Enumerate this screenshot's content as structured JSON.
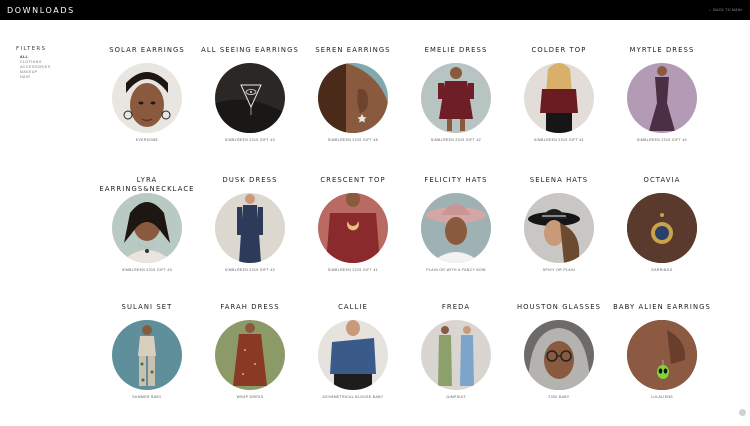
{
  "header": {
    "title": "DOWNLOADS",
    "back_link": "← BACK TO MAIN"
  },
  "filters": {
    "title": "FILTERS",
    "items": [
      {
        "label": "ALL",
        "active": true
      },
      {
        "label": "CLOTHING",
        "active": false
      },
      {
        "label": "ACCESSORIES",
        "active": false
      },
      {
        "label": "MAKEUP",
        "active": false
      },
      {
        "label": "HAIR",
        "active": false
      }
    ]
  },
  "items": [
    {
      "title": "SOLAR EARRINGS",
      "subtitle": "EVERSOME",
      "bg": "#e9e6e1",
      "motif": "face-earrings"
    },
    {
      "title": "ALL SEEING EARRINGS",
      "subtitle": "SIMBLREEN 2019 GIFT #3",
      "bg": "#2a2725",
      "motif": "eye-triangle"
    },
    {
      "title": "SEREN EARRINGS",
      "subtitle": "SIMBLREEN 2019 GIFT #5",
      "bg": "#7fa9ad",
      "motif": "ear-star"
    },
    {
      "title": "EMELIE DRESS",
      "subtitle": "SIMBLREEN 2019 GIFT #2",
      "bg": "#b8c4c2",
      "motif": "dress-red"
    },
    {
      "title": "COLDER TOP",
      "subtitle": "SIMBLREEN 2019 GIFT #1",
      "bg": "#e2ddd8",
      "motif": "top-maroon"
    },
    {
      "title": "MYRTLE DRESS",
      "subtitle": "SIMBLREEN 2019 GIFT #4",
      "bg": "#b39bb6",
      "motif": "gown-purple"
    },
    {
      "title": "LYRA EARRINGS&NECKLACE",
      "subtitle": "SIMBLREEN 2019 GIFT #3",
      "bg": "#b9c9c3",
      "motif": "face-necklace"
    },
    {
      "title": "DUSK DRESS",
      "subtitle": "SIMBLREEN 2019 GIFT #2",
      "bg": "#ddd8cf",
      "motif": "gown-navy"
    },
    {
      "title": "CRESCENT TOP",
      "subtitle": "SIMBLREEN 2019 GIFT #1",
      "bg": "#b86a63",
      "motif": "crescent-top"
    },
    {
      "title": "FELICITY HATS",
      "subtitle": "PLAIN OR WITH A FANCY BOW",
      "bg": "#9eb2b3",
      "motif": "hat-pink"
    },
    {
      "title": "SELENA HATS",
      "subtitle": "SPIKY OR PLAIN",
      "bg": "#c9c7c3",
      "motif": "hat-black"
    },
    {
      "title": "OCTAVIA",
      "subtitle": "EARRINGS",
      "bg": "#4a3128",
      "motif": "earring-gold"
    },
    {
      "title": "SULANI SET",
      "subtitle": "SUMMER BABY",
      "bg": "#5e8f9a",
      "motif": "set-print"
    },
    {
      "title": "FARAH DRESS",
      "subtitle": "WRAP DRESS",
      "bg": "#8c9a68",
      "motif": "dress-rust"
    },
    {
      "title": "CALLIE",
      "subtitle": "ASYMMETRICAL BLOUSE BABY",
      "bg": "#e6e2dd",
      "motif": "blouse-blue"
    },
    {
      "title": "FREDA",
      "subtitle": "JUMPSUIT",
      "bg": "#d9d6d1",
      "motif": "jumpsuits"
    },
    {
      "title": "HOUSTON GLASSES",
      "subtitle": "2000 BABY",
      "bg": "#6d6b6a",
      "motif": "glasses"
    },
    {
      "title": "BABY ALIEN EARRINGS",
      "subtitle": "LULALIENS",
      "bg": "#5b3327",
      "motif": "alien-earring"
    }
  ]
}
